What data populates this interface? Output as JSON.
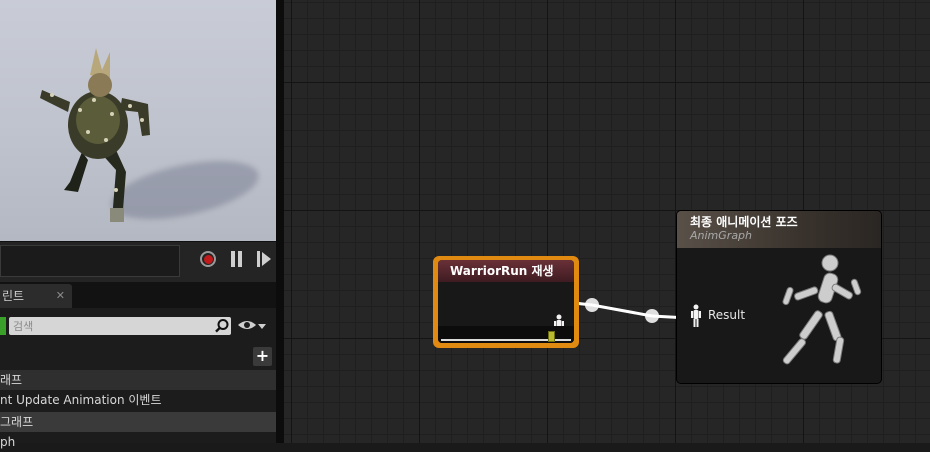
{
  "viewport": {
    "preview": "animated-character-preview"
  },
  "playback": {
    "record": "record-icon",
    "pause": "pause-icon",
    "play": "play-icon"
  },
  "panel": {
    "tab_label": "린트",
    "tab_close": "✕",
    "search_placeholder": "검색",
    "add_button": "+",
    "items": [
      {
        "label": "래프"
      },
      {
        "label": "nt Update Animation 이벤트"
      },
      {
        "label": "그래프"
      },
      {
        "label": "ph"
      }
    ]
  },
  "graph": {
    "node_play": {
      "title": "WarriorRun 재생"
    },
    "node_output": {
      "title": "최종 애니메이션 포즈",
      "subtitle": "AnimGraph",
      "pin_label": "Result"
    }
  },
  "colors": {
    "selection_outline": "#e08a12",
    "play_node_header": "#6a3038",
    "record_red": "#c11a1a",
    "add_green": "#3aa02a"
  }
}
